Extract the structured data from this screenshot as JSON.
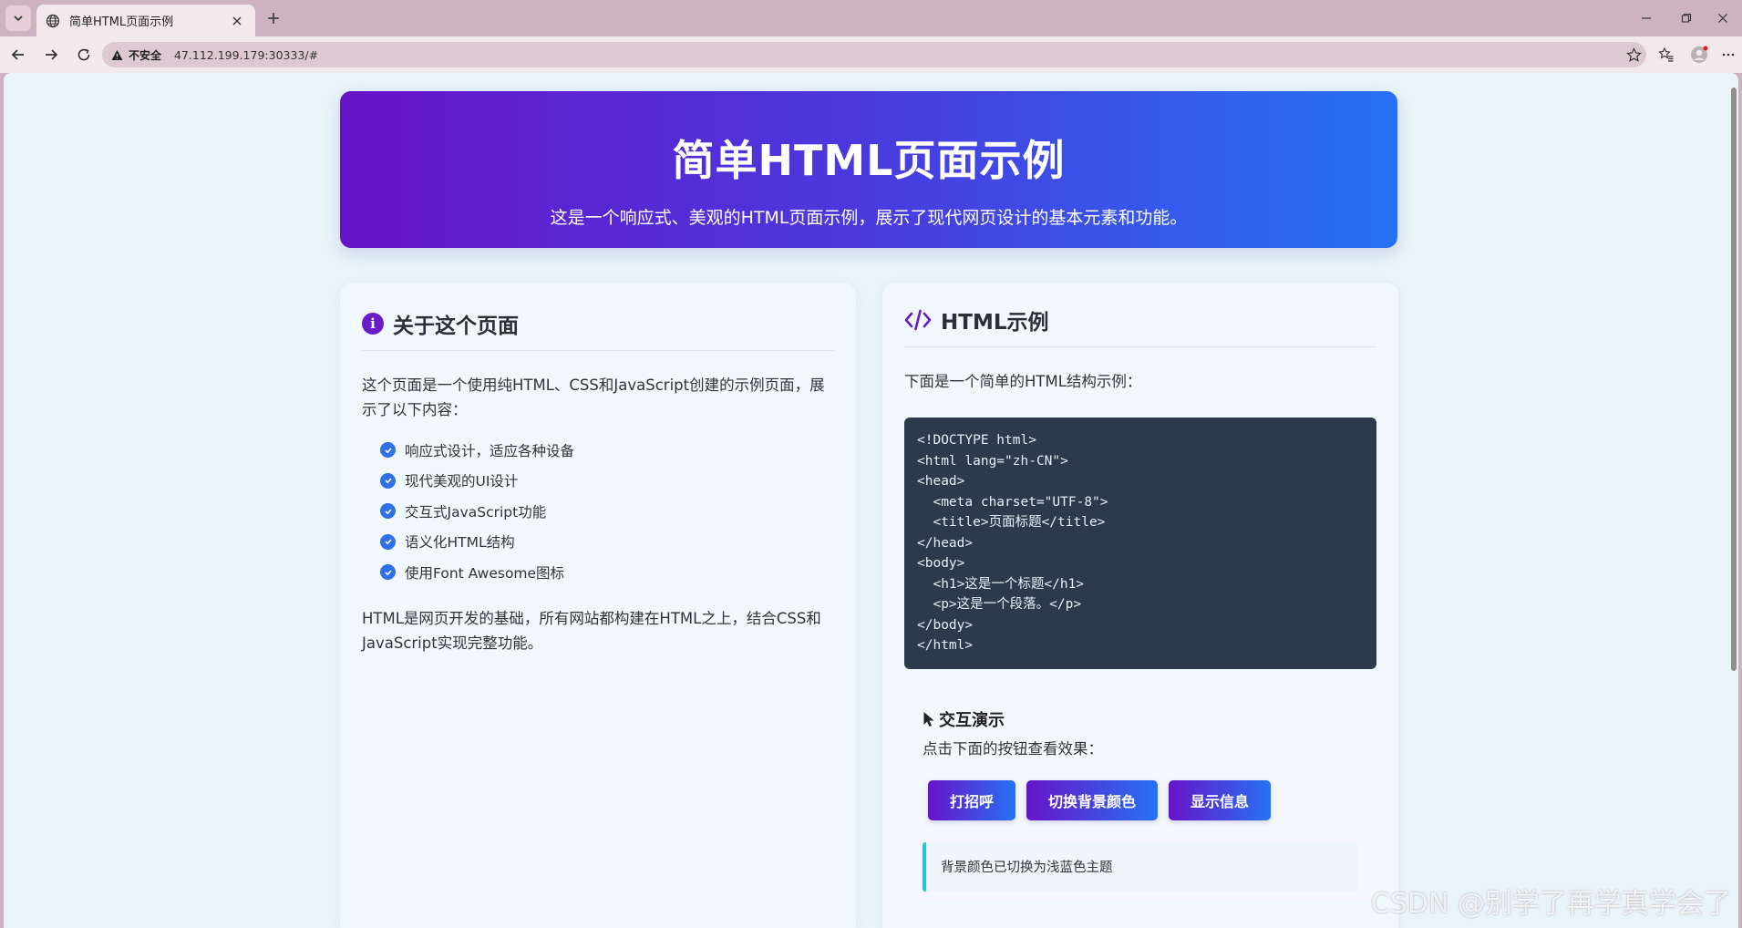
{
  "browser": {
    "tab_title": "简单HTML页面示例",
    "security_label": "不安全",
    "url": "47.112.199.179:30333/#"
  },
  "hero": {
    "title": "简单HTML页面示例",
    "subtitle": "这是一个响应式、美观的HTML页面示例，展示了现代网页设计的基本元素和功能。"
  },
  "about": {
    "title": "关于这个页面",
    "intro": "这个页面是一个使用纯HTML、CSS和JavaScript创建的示例页面，展示了以下内容：",
    "features": [
      "响应式设计，适应各种设备",
      "现代美观的UI设计",
      "交互式JavaScript功能",
      "语义化HTML结构",
      "使用Font Awesome图标"
    ],
    "outro": "HTML是网页开发的基础，所有网站都构建在HTML之上，结合CSS和JavaScript实现完整功能。"
  },
  "html_example": {
    "title": "HTML示例",
    "intro": "下面是一个简单的HTML结构示例：",
    "code_lines": [
      "<!DOCTYPE html>",
      "<html lang=\"zh-CN\">",
      "<head>",
      "  <meta charset=\"UTF-8\">",
      "  <title>页面标题</title>",
      "</head>",
      "<body>",
      "  <h1>这是一个标题</h1>",
      "  <p>这是一个段落。</p>",
      "</body>",
      "</html>"
    ]
  },
  "demo": {
    "title": "交互演示",
    "subtitle": "点击下面的按钮查看效果：",
    "buttons": [
      "打招呼",
      "切换背景颜色",
      "显示信息"
    ],
    "message": "背景颜色已切换为浅蓝色主题"
  },
  "watermark": "CSDN @别学了再学真学会了",
  "colors": {
    "accent_purple": "#6714c8",
    "accent_blue": "#2671f5",
    "check_blue": "#2f6fe8",
    "code_bg": "#2d3a4b",
    "message_border": "#26c4dc"
  }
}
